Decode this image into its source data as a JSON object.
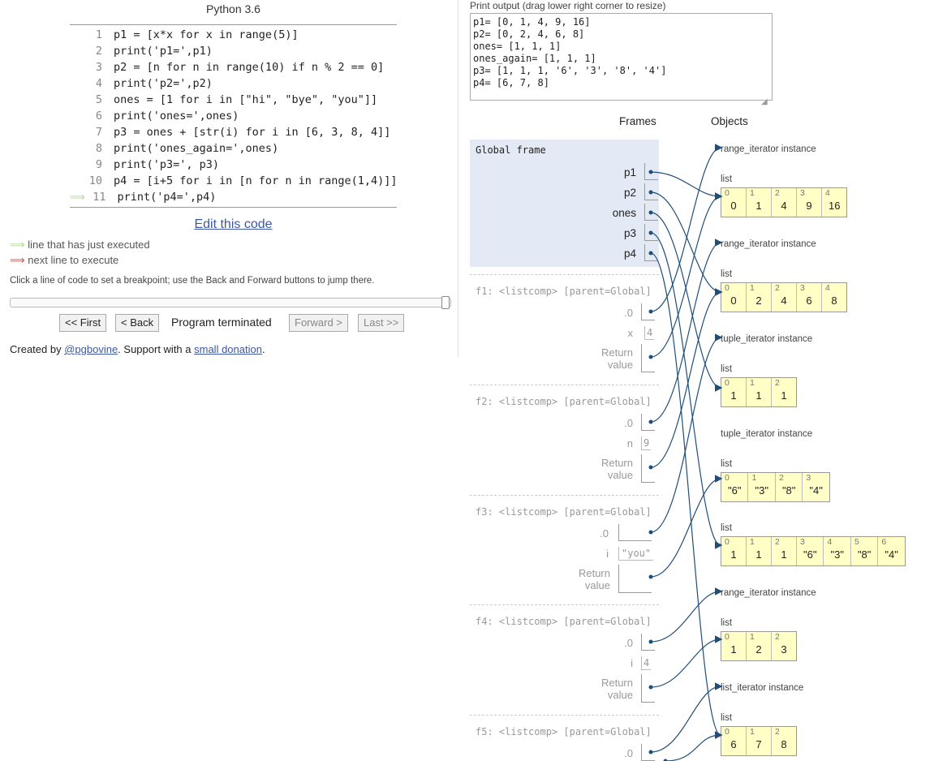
{
  "left": {
    "lang": "Python 3.6",
    "code_lines": [
      {
        "n": "1",
        "t": "p1 = [x*x for x in range(5)]"
      },
      {
        "n": "2",
        "t": "print('p1=',p1)"
      },
      {
        "n": "3",
        "t": "p2 = [n for n in range(10) if n % 2 == 0]"
      },
      {
        "n": "4",
        "t": "print('p2=',p2)"
      },
      {
        "n": "5",
        "t": "ones = [1 for i in [\"hi\", \"bye\", \"you\"]]"
      },
      {
        "n": "6",
        "t": "print('ones=',ones)"
      },
      {
        "n": "7",
        "t": "p3 = ones + [str(i) for i in [6, 3, 8, 4]]"
      },
      {
        "n": "8",
        "t": "print('ones_again=',ones)"
      },
      {
        "n": "9",
        "t": "print('p3=', p3)"
      },
      {
        "n": "10",
        "t": "p4 = [i+5 for i in [n for n in range(1,4)]]"
      },
      {
        "n": "11",
        "t": "print('p4=',p4)"
      }
    ],
    "edit": "Edit this code",
    "legend_green": "line that has just executed",
    "legend_red": "next line to execute",
    "hint": "Click a line of code to set a breakpoint; use the Back and Forward buttons to jump there.",
    "btn_first": "<< First",
    "btn_back": "< Back",
    "status": "Program terminated",
    "btn_forward": "Forward >",
    "btn_last": "Last >>",
    "credits_pre": "Created by ",
    "credits_link1": "@pgbovine",
    "credits_mid": ". Support with a ",
    "credits_link2": "small donation",
    "credits_post": "."
  },
  "right": {
    "output_label": "Print output (drag lower right corner to resize)",
    "output": "p1= [0, 1, 4, 9, 16]\np2= [0, 2, 4, 6, 8]\nones= [1, 1, 1]\nones_again= [1, 1, 1]\np3= [1, 1, 1, '6', '3', '8', '4']\np4= [6, 7, 8]",
    "frames_hdr": "Frames",
    "objects_hdr": "Objects",
    "global_title": "Global frame",
    "global_vars": [
      "p1",
      "p2",
      "ones",
      "p3",
      "p4"
    ],
    "f1": {
      "title": "f1: <listcomp> [parent=Global]",
      "v0": ".0",
      "v1": "x",
      "v1val": "4",
      "ret": "Return value"
    },
    "f2": {
      "title": "f2: <listcomp> [parent=Global]",
      "v0": ".0",
      "v1": "n",
      "v1val": "9",
      "ret": "Return value"
    },
    "f3": {
      "title": "f3: <listcomp> [parent=Global]",
      "v0": ".0",
      "v1": "i",
      "v1val": "\"you\"",
      "ret": "Return value"
    },
    "f4": {
      "title": "f4: <listcomp> [parent=Global]",
      "v0": ".0",
      "v1": "i",
      "v1val": "4",
      "ret": "Return value"
    },
    "f5": {
      "title": "f5: <listcomp> [parent=Global]",
      "v0": ".0"
    },
    "objects": {
      "o1": "range_iterator instance",
      "l1": {
        "label": "list",
        "vals": [
          "0",
          "1",
          "4",
          "9",
          "16"
        ]
      },
      "o2": "range_iterator instance",
      "l2": {
        "label": "list",
        "vals": [
          "0",
          "2",
          "4",
          "6",
          "8"
        ]
      },
      "o3": "tuple_iterator instance",
      "l3": {
        "label": "list",
        "vals": [
          "1",
          "1",
          "1"
        ]
      },
      "o4": "tuple_iterator instance",
      "l4": {
        "label": "list",
        "vals": [
          "\"6\"",
          "\"3\"",
          "\"8\"",
          "\"4\""
        ]
      },
      "l5": {
        "label": "list",
        "vals": [
          "1",
          "1",
          "1",
          "\"6\"",
          "\"3\"",
          "\"8\"",
          "\"4\""
        ]
      },
      "o5": "range_iterator instance",
      "l6": {
        "label": "list",
        "vals": [
          "1",
          "2",
          "3"
        ]
      },
      "o6": "list_iterator instance",
      "l7": {
        "label": "list",
        "vals": [
          "6",
          "7",
          "8"
        ]
      }
    }
  }
}
